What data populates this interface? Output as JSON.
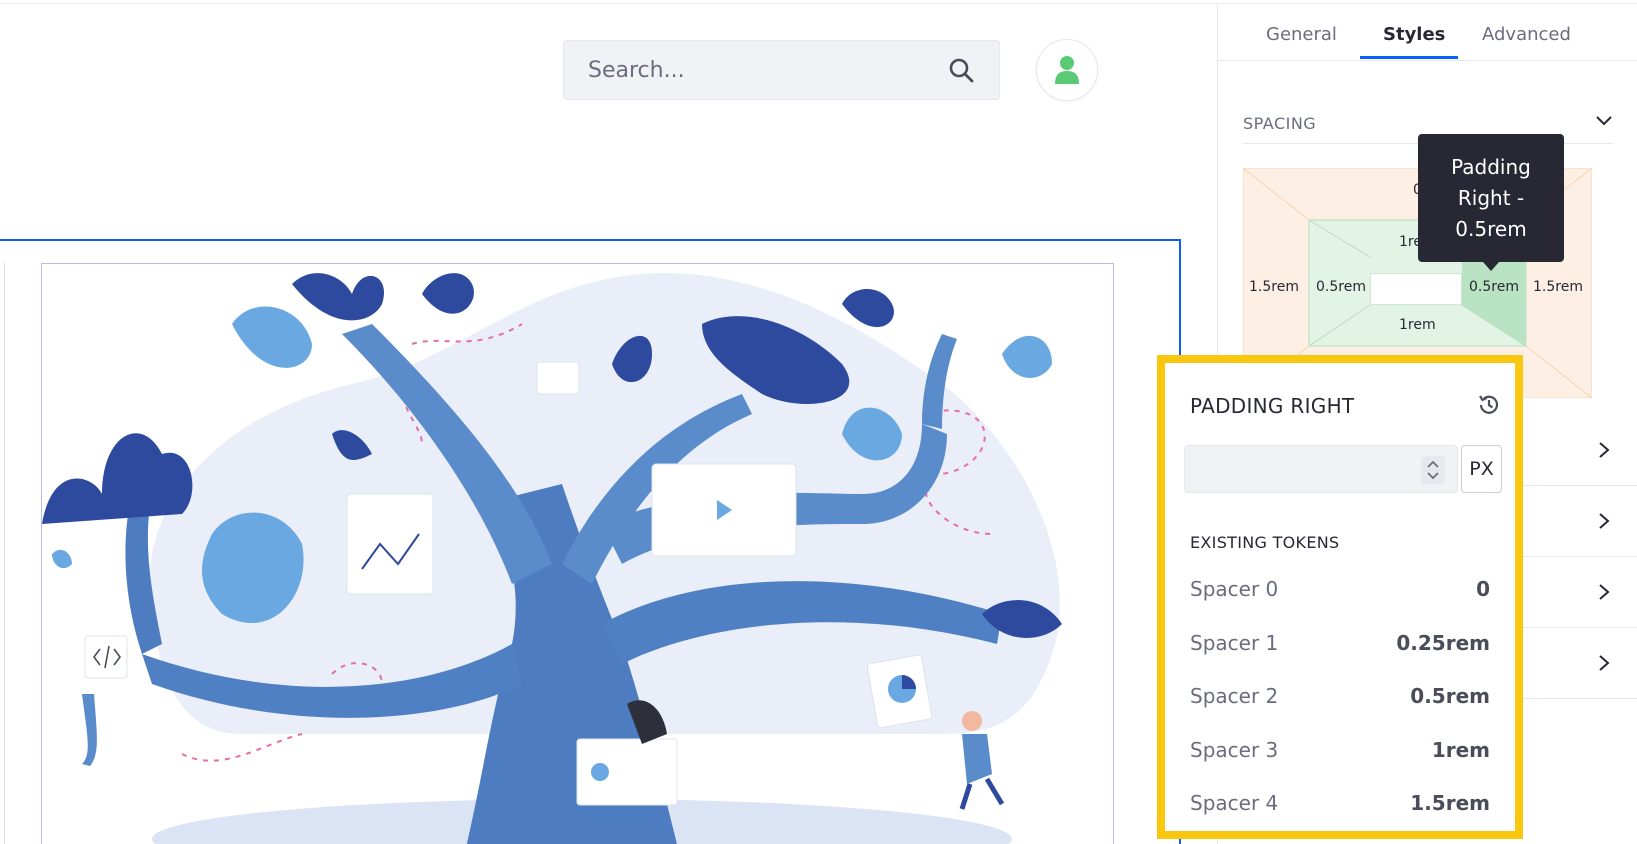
{
  "search": {
    "placeholder": "Search..."
  },
  "tabs": [
    {
      "label": "General",
      "active": false
    },
    {
      "label": "Styles",
      "active": true
    },
    {
      "label": "Advanced",
      "active": false
    }
  ],
  "spacing": {
    "title": "SPACING",
    "margin": {
      "top": "0",
      "left": "1.5rem",
      "right": "1.5rem"
    },
    "padding": {
      "top": "1rem",
      "bottom": "1rem",
      "left": "0.5rem",
      "right": "0.5rem"
    }
  },
  "tooltip": {
    "text": "Padding Right - 0.5rem"
  },
  "popover": {
    "title": "PADDING RIGHT",
    "value": "",
    "unit": "PX",
    "tokens_heading": "EXISTING TOKENS",
    "tokens": [
      {
        "name": "Spacer 0",
        "value": "0"
      },
      {
        "name": "Spacer 1",
        "value": "0.25rem"
      },
      {
        "name": "Spacer 2",
        "value": "0.5rem"
      },
      {
        "name": "Spacer 3",
        "value": "1rem"
      },
      {
        "name": "Spacer 4",
        "value": "1.5rem"
      }
    ]
  },
  "colors": {
    "accent": "#0b5fff",
    "highlight": "#f9c80e",
    "margin_fill": "#fdefe3",
    "padding_fill": "#e2f4e6",
    "padding_active": "#b9e3c2",
    "illustration_dark": "#2e4a9e",
    "illustration_mid": "#5b8fd0",
    "illustration_light": "#e9eef9"
  },
  "icons": [
    "search-icon",
    "user-icon",
    "chevron-down-icon",
    "chevron-right-icon",
    "reset-history-icon",
    "stepper-icon"
  ]
}
